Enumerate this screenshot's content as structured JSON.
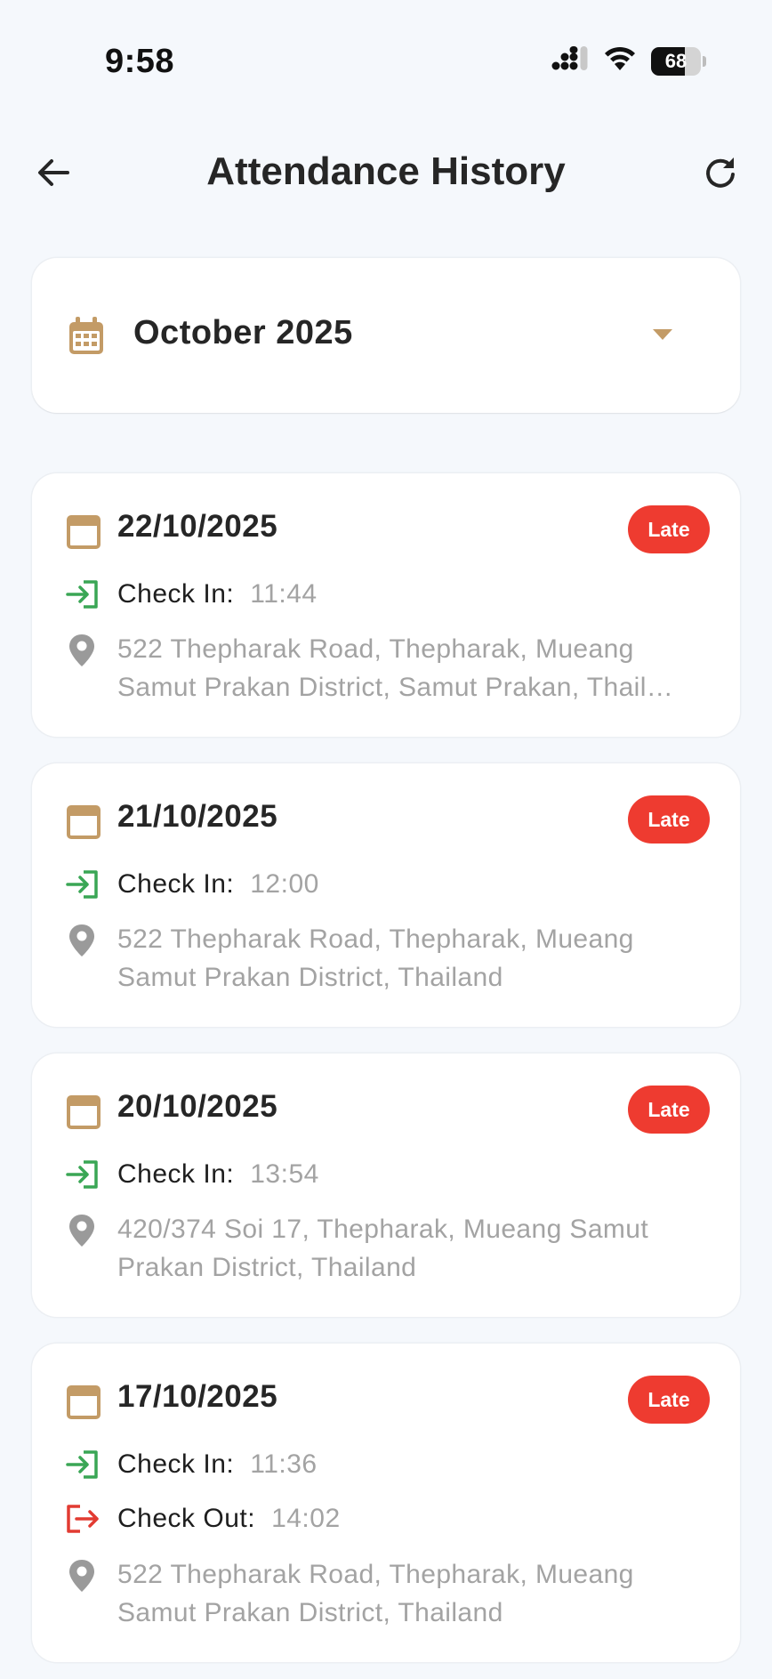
{
  "status_bar": {
    "time": "9:58",
    "battery_percent": "68",
    "battery_level": 0.68
  },
  "header": {
    "title": "Attendance History"
  },
  "month_selector": {
    "value": "October 2025"
  },
  "colors": {
    "accent": "#c39b66",
    "late_badge": "#ee3b30",
    "check_in": "#3aa655",
    "check_out": "#e23b32",
    "muted_text": "#a3a3a3",
    "background": "#f5f8fc"
  },
  "records": [
    {
      "date": "22/10/2025",
      "status": "Late",
      "check_in_label": "Check In:",
      "check_in_time": "11:44",
      "address": "522 Thepharak Road, Thepharak, Mueang Samut Prakan District, Samut Prakan, Thail…"
    },
    {
      "date": "21/10/2025",
      "status": "Late",
      "check_in_label": "Check In:",
      "check_in_time": "12:00",
      "address": "522 Thepharak Road, Thepharak, Mueang Samut Prakan District, Thailand"
    },
    {
      "date": "20/10/2025",
      "status": "Late",
      "check_in_label": "Check In:",
      "check_in_time": "13:54",
      "address": "420/374 Soi 17, Thepharak, Mueang Samut Prakan District, Thailand"
    },
    {
      "date": "17/10/2025",
      "status": "Late",
      "check_in_label": "Check In:",
      "check_in_time": "11:36",
      "check_out_label": "Check Out:",
      "check_out_time": "14:02",
      "address": "522 Thepharak Road, Thepharak, Mueang Samut Prakan District, Thailand"
    }
  ]
}
